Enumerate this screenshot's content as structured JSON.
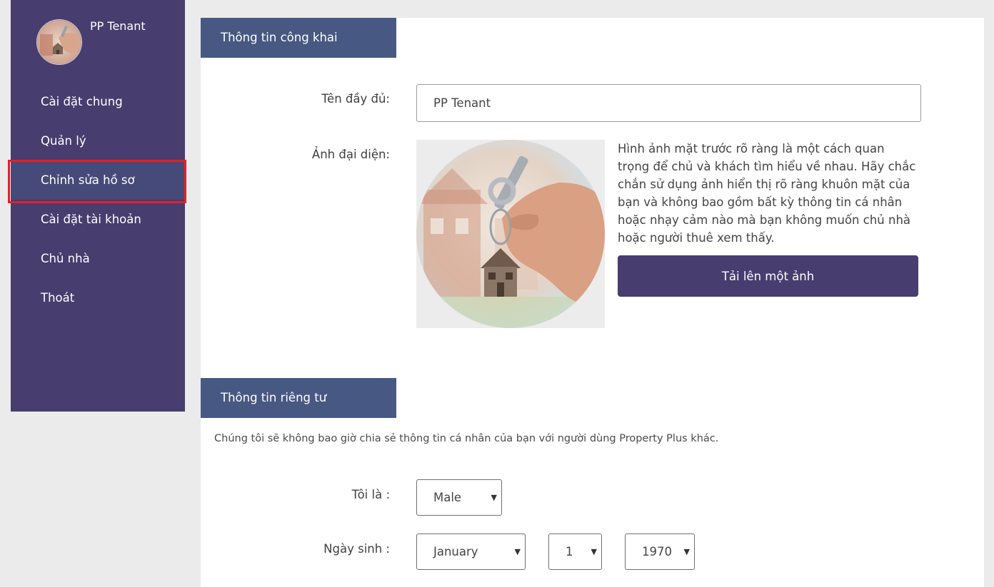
{
  "sidebar": {
    "user_name": "PP Tenant",
    "items": [
      {
        "label": "Cài đặt chung"
      },
      {
        "label": "Quản lý"
      },
      {
        "label": "Chỉnh sửa hồ sơ"
      },
      {
        "label": "Cài đặt tài khoản"
      },
      {
        "label": "Chủ nhà"
      },
      {
        "label": "Thoát"
      }
    ]
  },
  "public_section": {
    "title": "Thông tin công khai",
    "full_name_label": "Tên đầy đủ:",
    "full_name_value": "PP Tenant",
    "avatar_label": "Ảnh đại diện:",
    "avatar_description": "Hình ảnh mặt trước rõ ràng là một cách quan trọng để chủ và khách tìm hiểu về nhau. Hãy chắc chắn sử dụng ảnh hiển thị rõ ràng khuôn mặt của bạn và không bao gồm bất kỳ thông tin cá nhân hoặc nhạy cảm nào mà bạn không muốn chủ nhà hoặc người thuê xem thấy.",
    "upload_button": "Tải lên một ảnh"
  },
  "private_section": {
    "title": "Thông tin riêng tư",
    "note": "Chúng tôi sẽ không bao giờ chia sẻ thông tin cá nhân của bạn với người dùng Property Plus khác.",
    "gender_label": "Tôi là :",
    "gender_value": "Male",
    "birthday_label": "Ngày sinh :",
    "birth_month": "January",
    "birth_day": "1",
    "birth_year": "1970"
  },
  "colors": {
    "sidebar_bg": "#473d6e",
    "section_tab_bg": "#475882",
    "highlight": "#e3202b",
    "button_bg": "#473d6e"
  }
}
